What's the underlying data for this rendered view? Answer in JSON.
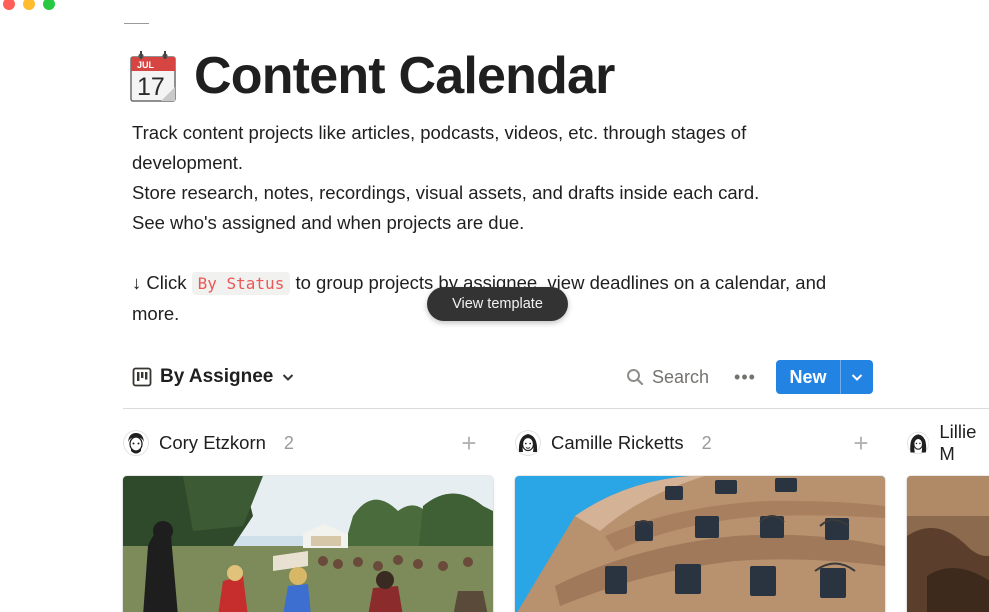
{
  "window": {
    "traffic_lights": [
      "close",
      "minimize",
      "zoom"
    ]
  },
  "page": {
    "icon": "calendar-icon",
    "icon_month": "JUL",
    "icon_day": "17",
    "title": "Content Calendar",
    "description": {
      "line1": "Track content projects like articles, podcasts, videos, etc. through stages of development.",
      "line2": "Store research, notes, recordings, visual assets, and drafts inside each card.",
      "line3": "See who's assigned and when projects are due.",
      "hint_prefix": "↓ Click ",
      "hint_code": "By Status",
      "hint_suffix": " to group projects by assignee, view deadlines on a calendar, and more."
    }
  },
  "tooltip": {
    "label": "View template"
  },
  "toolbar": {
    "view_label": "By Assignee",
    "search_label": "Search",
    "more_label": "•••",
    "new_label": "New"
  },
  "board": {
    "columns": [
      {
        "name": "Cory Etzkorn",
        "count": "2"
      },
      {
        "name": "Camille Ricketts",
        "count": "2"
      },
      {
        "name": "Lillie M"
      }
    ]
  },
  "colors": {
    "accent": "#2383e2",
    "code_text": "#eb5757",
    "code_bg": "#f1f1ef",
    "tooltip_bg": "#333333"
  }
}
